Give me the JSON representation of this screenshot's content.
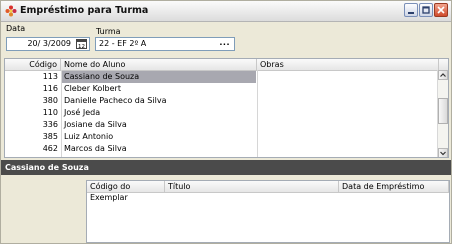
{
  "window": {
    "title": "Empréstimo para Turma",
    "controls": [
      "minimize",
      "maximize",
      "close"
    ],
    "icon": "app-flower-icon"
  },
  "filters": {
    "data_label": "Data",
    "data_value": "20/ 3/2009",
    "turma_label": "Turma",
    "turma_value": "22 - EF 2º A",
    "turma_button": "..."
  },
  "students_grid": {
    "columns": [
      "Código",
      "Nome do Aluno",
      "Obras"
    ],
    "rows": [
      {
        "codigo": "113",
        "nome": "Cassiano de Souza",
        "selected": true
      },
      {
        "codigo": "116",
        "nome": "Cleber Kolbert"
      },
      {
        "codigo": "380",
        "nome": "Danielle Pacheco da Silva"
      },
      {
        "codigo": "110",
        "nome": "José Jeda"
      },
      {
        "codigo": "336",
        "nome": "Josiane da Silva"
      },
      {
        "codigo": "385",
        "nome": "Luiz Antonio"
      },
      {
        "codigo": "462",
        "nome": "Marcos da Silva"
      }
    ]
  },
  "detail": {
    "selected_student": "Cassiano de Souza",
    "columns": [
      "Código do Exemplar",
      "Título",
      "Data de Empréstimo"
    ]
  },
  "colors": {
    "selection": "#a8a8b0",
    "band": "#4b4b4b",
    "window_bg": "#ece9d8"
  }
}
